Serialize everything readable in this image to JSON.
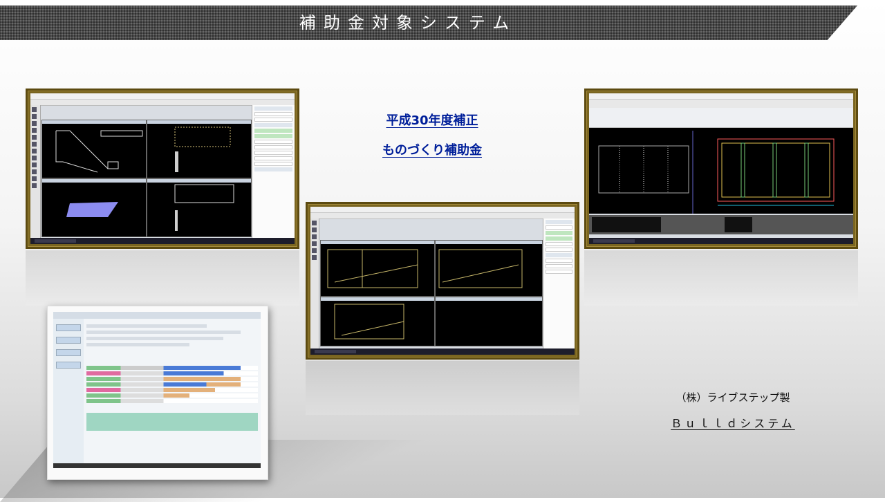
{
  "header": {
    "title": "補助金対象システム"
  },
  "subsidy": {
    "line1": "平成30年度補正",
    "line2": "ものづくり補助金"
  },
  "maker": {
    "company": "（株）ライブステップ製",
    "system": "Ｂｕｌｌｄシステム"
  },
  "colors": {
    "frame": "#7a6520",
    "subsidy_text": "#001f9a",
    "banner": "#4a4a4a"
  }
}
